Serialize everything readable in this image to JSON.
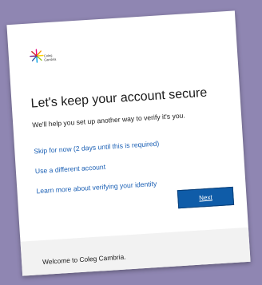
{
  "brand": {
    "logo_text_line1": "Coleg",
    "logo_text_line2": "Cambria"
  },
  "main": {
    "title": "Let's keep your account secure",
    "subtitle": "We'll help you set up another way to verify it's you.",
    "links": {
      "skip": "Skip for now (2 days until this is required)",
      "different_account": "Use a different account",
      "learn_more": "Learn more about verifying your identity"
    },
    "next_label": "Next"
  },
  "footer": {
    "text": "Welcome to Coleg Cambria."
  }
}
